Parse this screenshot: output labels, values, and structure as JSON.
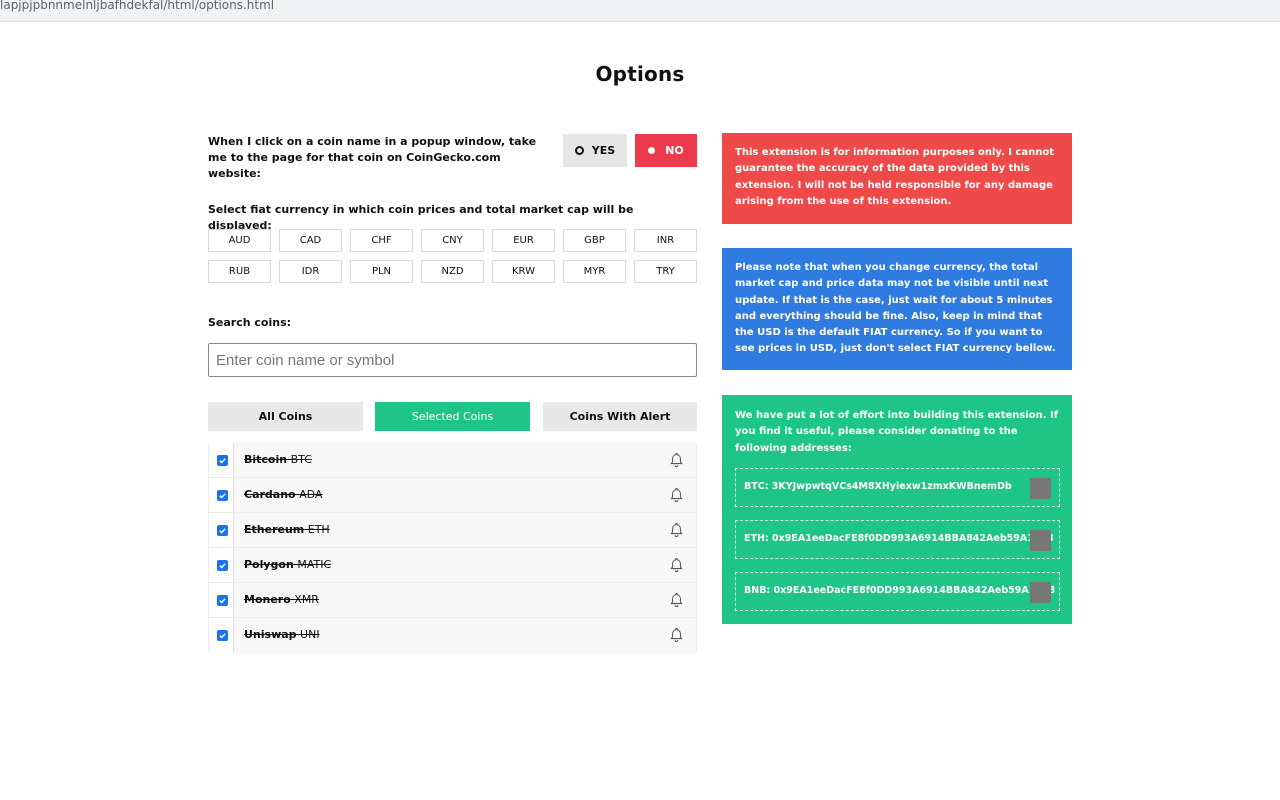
{
  "browser": {
    "url": "lapjpjpbnnmelnljbafhdekfal/html/options.html"
  },
  "page": {
    "title": "Options"
  },
  "popup_setting": {
    "label": "When I click on a coin name in a popup window, take me to the page for that coin on CoinGecko.com website:",
    "yes_label": "YES",
    "no_label": "NO",
    "selected": "NO"
  },
  "fiat": {
    "label": "Select fiat currency in which coin prices and total market cap will be displayed:",
    "currencies": [
      "AUD",
      "CAD",
      "CHF",
      "CNY",
      "EUR",
      "GBP",
      "INR",
      "RUB",
      "IDR",
      "PLN",
      "NZD",
      "KRW",
      "MYR",
      "TRY"
    ]
  },
  "search": {
    "label": "Search coins:",
    "placeholder": "Enter coin name or symbol",
    "value": ""
  },
  "tabs": [
    "All Coins",
    "Selected Coins",
    "Coins With Alert"
  ],
  "active_tab": "Selected Coins",
  "coins": [
    {
      "name": "Bitcoin",
      "symbol": "BTC",
      "checked": true
    },
    {
      "name": "Cardano",
      "symbol": "ADA",
      "checked": true
    },
    {
      "name": "Ethereum",
      "symbol": "ETH",
      "checked": true
    },
    {
      "name": "Polygon",
      "symbol": "MATIC",
      "checked": true
    },
    {
      "name": "Monero",
      "symbol": "XMR",
      "checked": true
    },
    {
      "name": "Uniswap",
      "symbol": "UNI",
      "checked": true
    }
  ],
  "notices": {
    "disclaimer": "This extension is for information purposes only. I cannot guarantee the accuracy of the data provided by this extension. I will not be held responsible for any damage arising from the use of this extension.",
    "currency_note": "Please note that when you change currency, the total market cap and price data may not be visible until next update. If that is the case, just wait for about 5 minutes and everything should be fine. Also, keep in mind that the USD is the default FIAT currency. So if you want to see prices in USD, just don't select FIAT currency bellow.",
    "donate": "We have put a lot of effort into building this extension. If you find it useful, please consider donating to the following addresses:"
  },
  "donations": [
    {
      "label": "BTC: 3KYJwpwtqVCs4M8XHyiexw1zmxKWBnemDb"
    },
    {
      "label": "ETH: 0x9EA1eeDacFE8f0DD993A6914BBA842Aeb59A1778"
    },
    {
      "label": "BNB: 0x9EA1eeDacFE8f0DD993A6914BBA842Aeb59A1778"
    }
  ],
  "colors": {
    "red": "#ef4a4a",
    "blue": "#2f7be0",
    "green": "#1ec587",
    "no_button": "#ea3a4b"
  }
}
